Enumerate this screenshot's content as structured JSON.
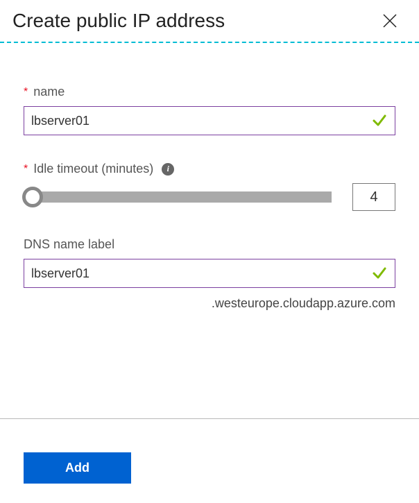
{
  "header": {
    "title": "Create public IP address"
  },
  "fields": {
    "name": {
      "label": "name",
      "value": "lbserver01",
      "required": true,
      "valid": true
    },
    "idle_timeout": {
      "label": "Idle timeout (minutes)",
      "value": "4",
      "required": true
    },
    "dns": {
      "label": "DNS name label",
      "value": "lbserver01",
      "suffix": ".westeurope.cloudapp.azure.com",
      "required": false,
      "valid": true
    }
  },
  "buttons": {
    "add": "Add"
  }
}
